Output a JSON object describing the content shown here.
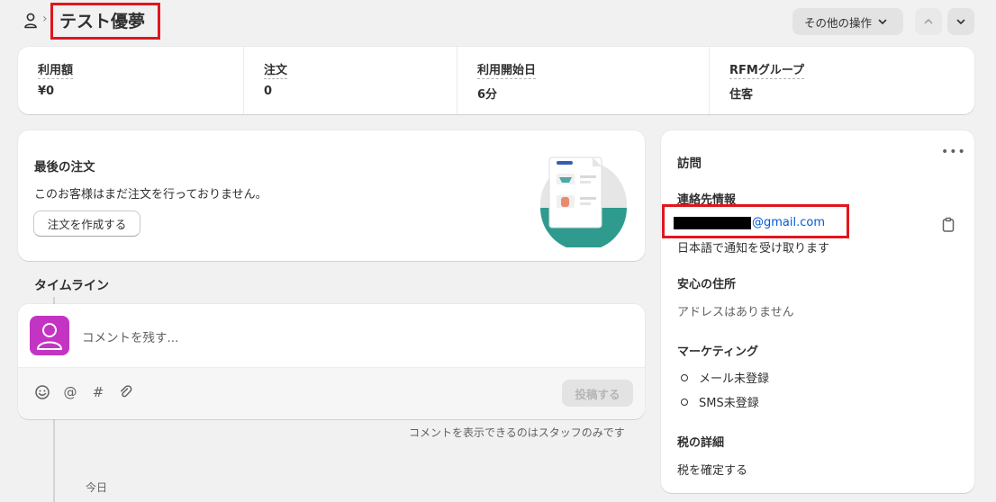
{
  "header": {
    "title": "テスト優夢",
    "more_actions_label": "その他の操作"
  },
  "stats": [
    {
      "label": "利用額",
      "value": "¥0"
    },
    {
      "label": "注文",
      "value": "0"
    },
    {
      "label": "利用開始日",
      "value": "6分"
    },
    {
      "label": "RFMグループ",
      "value": "住客"
    }
  ],
  "last_order": {
    "title": "最後の注文",
    "description": "このお客様はまだ注文を行っておりません。",
    "create_button": "注文を作成する"
  },
  "timeline": {
    "title": "タイムライン",
    "comment_placeholder": "コメントを残す...",
    "post_button": "投稿する",
    "staff_note": "コメントを表示できるのはスタッフのみです",
    "today_label": "今日"
  },
  "side": {
    "visit_title": "訪問",
    "contact_title": "連絡先情報",
    "email_suffix": "@gmail.com",
    "notify_lang": "日本語で通知を受け取ります",
    "address_title": "安心の住所",
    "address_empty": "アドレスはありません",
    "marketing_title": "マーケティング",
    "marketing_items": [
      "メール未登録",
      "SMS未登録"
    ],
    "tax_title": "税の詳細",
    "tax_value": "税を確定する"
  },
  "colors": {
    "highlight_border": "#e0161e",
    "avatar_bg": "#c334c2",
    "link": "#005bd3"
  },
  "icons": {
    "breadcrumb": "person-icon",
    "actions": "chevron-down-icon",
    "prev": "chevron-up-icon",
    "next": "chevron-down-icon",
    "visit_menu": "more-horizontal-icon",
    "copy": "clipboard-icon",
    "toolbar": [
      "emoji-icon",
      "mention-icon",
      "hashtag-icon",
      "attachment-icon"
    ]
  }
}
